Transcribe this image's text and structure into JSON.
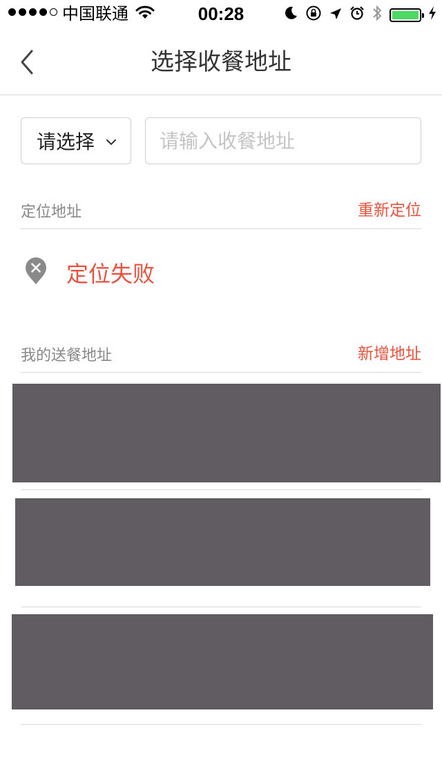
{
  "status_bar": {
    "carrier": "中国联通",
    "time": "00:28",
    "battery_level": 1.0,
    "battery_color": "#4cd964"
  },
  "nav": {
    "title": "选择收餐地址",
    "back_icon": "chevron-left-icon"
  },
  "search": {
    "select_label": "请选择",
    "input_value": "",
    "input_placeholder": "请输入收餐地址"
  },
  "location_section": {
    "title": "定位地址",
    "action": "重新定位",
    "status_icon": "location-fail-icon",
    "status_text": "定位失败"
  },
  "my_addresses_section": {
    "title": "我的送餐地址",
    "action": "新增地址",
    "items_count_shown": 3,
    "card_color": "#615b62"
  },
  "colors": {
    "accent": "#e8533f",
    "muted_text": "#888888",
    "divider": "#d9d9d9"
  }
}
